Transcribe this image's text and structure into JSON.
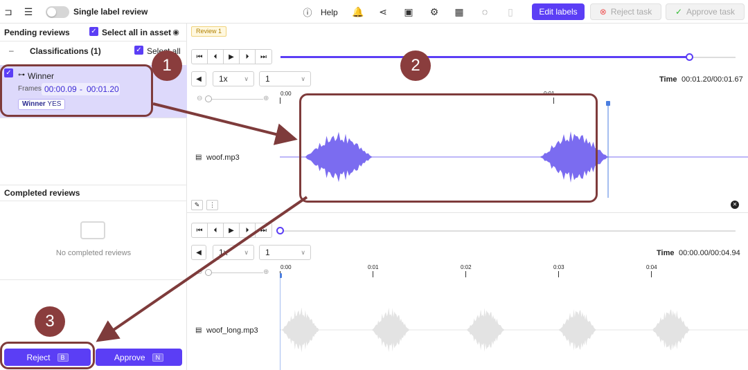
{
  "topbar": {
    "single_label_review": "Single label review",
    "help": "Help",
    "edit_labels": "Edit labels",
    "reject_task": "Reject task",
    "approve_task": "Approve task"
  },
  "left": {
    "pending_reviews": "Pending reviews",
    "select_all_in_asset": "Select all in asset",
    "classifications": "Classifications (1)",
    "select_all": "Select all",
    "item": {
      "title": "Winner",
      "frames_label": "Frames",
      "frame_start": "00:00.09",
      "frame_sep": "-",
      "frame_end": "00:01.20",
      "tag_name": "Winner",
      "tag_value": "YES"
    },
    "completed_reviews": "Completed reviews",
    "no_completed": "No completed reviews",
    "reject": "Reject",
    "reject_key": "B",
    "approve": "Approve",
    "approve_key": "N"
  },
  "right": {
    "review_badge": "Review 1",
    "track1": {
      "speed": "1x",
      "channel": "1",
      "time_label": "Time",
      "time_value": "00:01.20/00:01.67",
      "tick0": "0:00",
      "tick1": "0:01",
      "file": "woof.mp3",
      "progress": 0.9
    },
    "track2": {
      "speed": "1x",
      "channel": "1",
      "time_label": "Time",
      "time_value": "00:00.00/00:04.94",
      "ticks": [
        "0:00",
        "0:01",
        "0:02",
        "0:03",
        "0:04"
      ],
      "file": "woof_long.mp3",
      "progress": 0.0
    }
  },
  "annotations": [
    "1",
    "2",
    "3"
  ],
  "colors": {
    "accent": "#5b3ef5",
    "waveform": "#7b6cf0",
    "annotation": "#8a3d3d"
  }
}
